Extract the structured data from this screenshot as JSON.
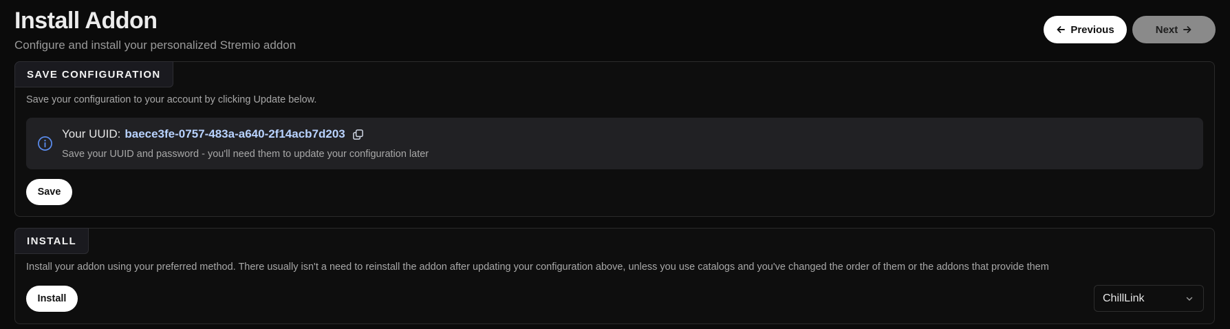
{
  "header": {
    "title": "Install Addon",
    "subtitle": "Configure and install your personalized Stremio addon"
  },
  "nav": {
    "previous_label": "Previous",
    "next_label": "Next"
  },
  "save_section": {
    "label": "SAVE CONFIGURATION",
    "description": "Save your configuration to your account by clicking Update below.",
    "uuid_prefix": "Your UUID:",
    "uuid_value": "baece3fe-0757-483a-a640-2f14acb7d203",
    "uuid_note": "Save your UUID and password - you'll need them to update your configuration later",
    "save_label": "Save"
  },
  "install_section": {
    "label": "INSTALL",
    "description": "Install your addon using your preferred method. There usually isn't a need to reinstall the addon after updating your configuration above, unless you use catalogs and you've changed the order of them or the addons that provide them",
    "install_label": "Install",
    "method_selected": "ChillLink"
  },
  "colors": {
    "accent_info": "#5b8def",
    "uuid_text": "#b9d3ff",
    "next_button_bg": "#8a8a8a"
  },
  "icons": {
    "previous": "arrow-left-icon",
    "next": "arrow-right-icon",
    "info": "info-icon",
    "copy": "copy-icon",
    "dropdown": "chevron-down-icon"
  }
}
